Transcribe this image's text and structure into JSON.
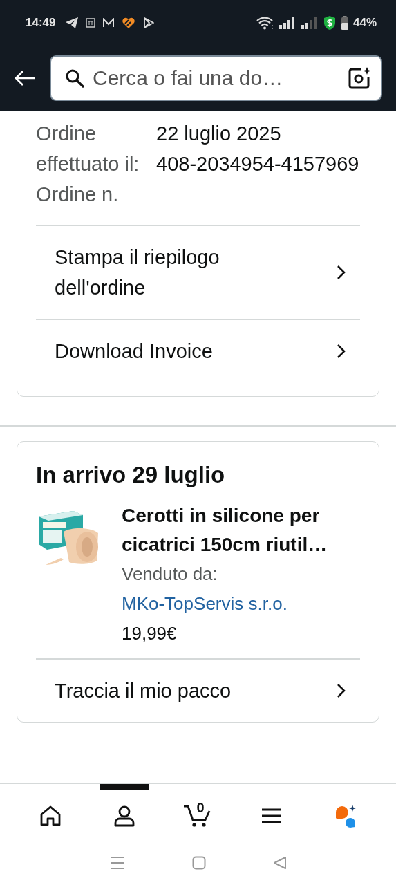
{
  "status_bar": {
    "time": "14:49",
    "battery": "44%"
  },
  "header": {
    "search": {
      "placeholder": "Cerca o fai una do…"
    }
  },
  "order_info": {
    "labels": [
      "Ordine effettuato il:",
      "Ordine n."
    ],
    "values": [
      "22 luglio 2025",
      "408-2034954-4157969"
    ]
  },
  "order_links": [
    "Stampa il riepilogo dell'ordine",
    "Download Invoice"
  ],
  "shipment": {
    "heading": "In arrivo 29 luglio",
    "product": {
      "kind": "picture",
      "title": "Cerotti in silicone per cicatrici 150cm riutil…",
      "seller_label": "Venduto da:",
      "seller": "MKo-TopServis s.r.o.",
      "price": "19,99€"
    },
    "actions": [
      "Traccia il mio pacco"
    ]
  },
  "bottom_nav": [
    {
      "kind": "home",
      "selected": false
    },
    {
      "kind": "account",
      "selected": true
    },
    {
      "kind": "cart",
      "badge": "0",
      "selected": false
    },
    {
      "kind": "menu",
      "selected": false
    },
    {
      "kind": "assistant",
      "selected": false
    }
  ]
}
